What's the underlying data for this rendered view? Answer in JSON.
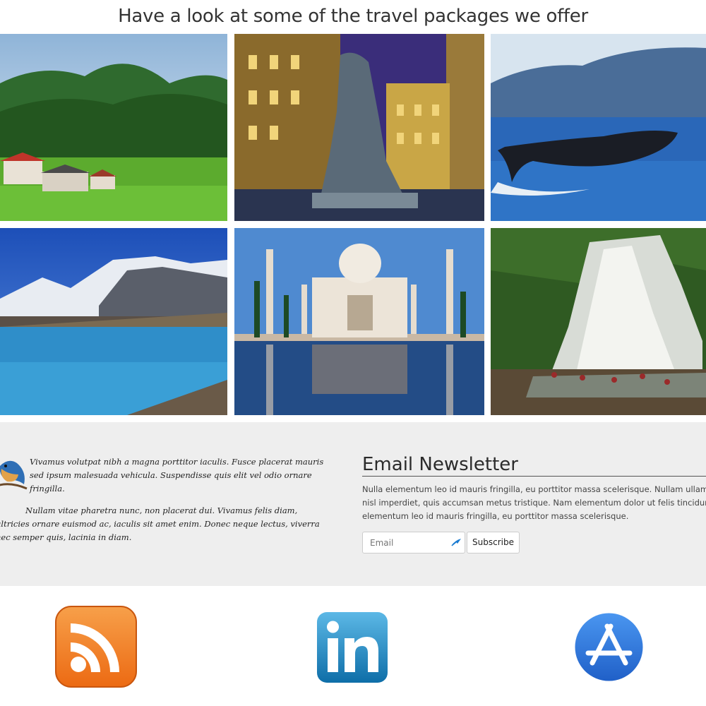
{
  "headline": "Have a look at some of the travel packages we offer",
  "packages": [
    {
      "name": "meadow-resort-image"
    },
    {
      "name": "city-fountain-image"
    },
    {
      "name": "whale-lake-image"
    },
    {
      "name": "mountain-lake-image"
    },
    {
      "name": "taj-mahal-image"
    },
    {
      "name": "waterfall-image"
    }
  ],
  "quote": {
    "p1": "Vivamus volutpat nibh a magna porttitor iaculis. Fusce placerat mauris sed ipsum malesuada vehicula. Suspendisse quis elit vel odio ornare fringilla.",
    "p2": "Nullam vitae pharetra nunc, non placerat dui. Vivamus felis diam, ultricies ornare euismod ac, iaculis sit amet enim. Donec neque lectus, viverra nec semper quis, lacinia in diam."
  },
  "newsletter": {
    "title": "Email Newsletter",
    "line1": "Nulla elementum leo id mauris fringilla, eu porttitor massa scelerisque. Nullam ullamcorper nisl eget",
    "line2": "nisl imperdiet, quis accumsan metus tristique. Nam elementum dolor ut felis tincidunt auctor. Nulla",
    "line3": "elementum leo id mauris fringilla, eu porttitor massa scelerisque.",
    "email_placeholder": "Email",
    "subscribe_label": "Subscribe"
  },
  "social": [
    "rss-icon",
    "linkedin-icon",
    "app-store-icon"
  ],
  "colors": {
    "band": "#eeeeee",
    "rss": "#f07a1f",
    "linkedin": "#1e88c7",
    "appstore": "#2f7bdf"
  }
}
